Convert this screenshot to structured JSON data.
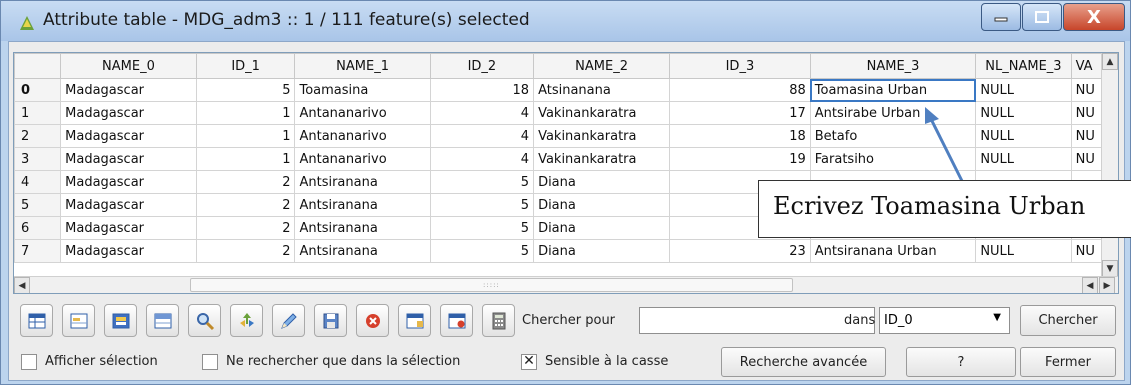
{
  "window": {
    "title": "Attribute table - MDG_adm3 :: 1 / 111 feature(s) selected",
    "accent_color": "#3a78c4",
    "close_label": "X"
  },
  "table": {
    "columns": [
      "NAME_0",
      "ID_1",
      "NAME_1",
      "ID_2",
      "NAME_2",
      "ID_3",
      "NAME_3",
      "NL_NAME_3",
      "VA"
    ],
    "rows": [
      {
        "index": "0",
        "cells": [
          "Madagascar",
          "5",
          "Toamasina",
          "18",
          "Atsinanana",
          "88",
          "Toamasina Urban",
          "NULL",
          "NU"
        ]
      },
      {
        "index": "1",
        "cells": [
          "Madagascar",
          "1",
          "Antananarivo",
          "4",
          "Vakinankaratra",
          "17",
          "Antsirabe Urban",
          "NULL",
          "NU"
        ]
      },
      {
        "index": "2",
        "cells": [
          "Madagascar",
          "1",
          "Antananarivo",
          "4",
          "Vakinankaratra",
          "18",
          "Betafo",
          "NULL",
          "NU"
        ]
      },
      {
        "index": "3",
        "cells": [
          "Madagascar",
          "1",
          "Antananarivo",
          "4",
          "Vakinankaratra",
          "19",
          "Faratsiho",
          "NULL",
          "NU"
        ]
      },
      {
        "index": "4",
        "cells": [
          "Madagascar",
          "2",
          "Antsiranana",
          "5",
          "Diana",
          "",
          "",
          "",
          ""
        ]
      },
      {
        "index": "5",
        "cells": [
          "Madagascar",
          "2",
          "Antsiranana",
          "5",
          "Diana",
          "",
          "",
          "",
          ""
        ]
      },
      {
        "index": "6",
        "cells": [
          "Madagascar",
          "2",
          "Antsiranana",
          "5",
          "Diana",
          "",
          "",
          "",
          ""
        ]
      },
      {
        "index": "7",
        "cells": [
          "Madagascar",
          "2",
          "Antsiranana",
          "5",
          "Diana",
          "23",
          "Antsiranana Urban",
          "NULL",
          "NU"
        ]
      }
    ]
  },
  "annotation": {
    "text": "Ecrivez Toamasina Urban"
  },
  "toolbar": {
    "icons": [
      "table-icon",
      "zoom-to-selection-icon",
      "invert-selection-icon",
      "move-to-top-icon",
      "search-icon",
      "pan-icon",
      "edit-pencil-icon",
      "save-icon",
      "delete-icon",
      "new-column-icon",
      "delete-column-icon",
      "calculator-icon"
    ],
    "search_label": "Chercher pour",
    "search_value": "",
    "in_label": "dans",
    "field_value": "ID_0",
    "search_button": "Chercher"
  },
  "footer": {
    "show_selection": "Afficher sélection",
    "search_selection_only": "Ne rechercher que dans la sélection",
    "case_sensitive": "Sensible à la casse",
    "case_sensitive_checked": true,
    "advanced_search": "Recherche avancée",
    "help": "?",
    "close": "Fermer"
  }
}
